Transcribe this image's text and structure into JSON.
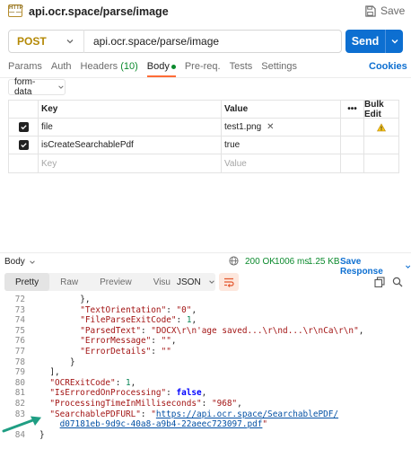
{
  "header": {
    "title": "api.ocr.space/parse/image",
    "save_label": "Save"
  },
  "request": {
    "method": "POST",
    "url": "api.ocr.space/parse/image",
    "send_label": "Send"
  },
  "tabs": [
    {
      "label": "Params"
    },
    {
      "label": "Auth"
    },
    {
      "label": "Headers",
      "count": "(10)"
    },
    {
      "label": "Body",
      "active": true,
      "dot": true
    },
    {
      "label": "Pre-req."
    },
    {
      "label": "Tests"
    },
    {
      "label": "Settings"
    }
  ],
  "cookies_label": "Cookies",
  "body_type": "form-data",
  "kv_table": {
    "headers": {
      "key": "Key",
      "value": "Value",
      "bulk": "Bulk Edit"
    },
    "rows": [
      {
        "checked": true,
        "key": "file",
        "value": "test1.png",
        "file": true,
        "warning": true
      },
      {
        "checked": true,
        "key": "isCreateSearchablePdf",
        "value": "true"
      }
    ],
    "placeholder": {
      "key": "Key",
      "value": "Value"
    }
  },
  "response": {
    "section_label": "Body",
    "status": "200 OK",
    "time": "1006 ms",
    "size": "1.25 KB",
    "save_label": "Save Response",
    "view_tabs": [
      "Pretty",
      "Raw",
      "Preview",
      "Visualize"
    ],
    "active_view": "Pretty",
    "format": "JSON"
  },
  "code_lines": [
    {
      "n": "72",
      "indent": 8,
      "parts": [
        [
          "p",
          "},"
        ]
      ]
    },
    {
      "n": "73",
      "indent": 8,
      "parts": [
        [
          "k",
          "\"TextOrientation\""
        ],
        [
          "p",
          ": "
        ],
        [
          "s",
          "\"0\""
        ],
        [
          "p",
          ","
        ]
      ]
    },
    {
      "n": "74",
      "indent": 8,
      "parts": [
        [
          "k",
          "\"FileParseExitCode\""
        ],
        [
          "p",
          ": "
        ],
        [
          "n",
          "1"
        ],
        [
          "p",
          ","
        ]
      ]
    },
    {
      "n": "75",
      "indent": 8,
      "parts": [
        [
          "k",
          "\"ParsedText\""
        ],
        [
          "p",
          ": "
        ],
        [
          "s",
          "\"DOCX\\r\\n'age saved...\\r\\nd...\\r\\nCa\\r\\n\""
        ],
        [
          "p",
          ","
        ]
      ]
    },
    {
      "n": "76",
      "indent": 8,
      "parts": [
        [
          "k",
          "\"ErrorMessage\""
        ],
        [
          "p",
          ": "
        ],
        [
          "s",
          "\"\""
        ],
        [
          "p",
          ","
        ]
      ]
    },
    {
      "n": "77",
      "indent": 8,
      "parts": [
        [
          "k",
          "\"ErrorDetails\""
        ],
        [
          "p",
          ": "
        ],
        [
          "s",
          "\"\""
        ]
      ]
    },
    {
      "n": "78",
      "indent": 6,
      "parts": [
        [
          "p",
          "}"
        ]
      ]
    },
    {
      "n": "79",
      "indent": 2,
      "parts": [
        [
          "p",
          "],"
        ]
      ]
    },
    {
      "n": "80",
      "indent": 2,
      "parts": [
        [
          "k",
          "\"OCRExitCode\""
        ],
        [
          "p",
          ": "
        ],
        [
          "n",
          "1"
        ],
        [
          "p",
          ","
        ]
      ]
    },
    {
      "n": "81",
      "indent": 2,
      "parts": [
        [
          "k",
          "\"IsErroredOnProcessing\""
        ],
        [
          "p",
          ": "
        ],
        [
          "b",
          "false"
        ],
        [
          "p",
          ","
        ]
      ]
    },
    {
      "n": "82",
      "indent": 2,
      "parts": [
        [
          "k",
          "\"ProcessingTimeInMilliseconds\""
        ],
        [
          "p",
          ": "
        ],
        [
          "s",
          "\"968\""
        ],
        [
          "p",
          ","
        ]
      ]
    },
    {
      "n": "83",
      "indent": 2,
      "parts": [
        [
          "k",
          "\"SearchablePDFURL\""
        ],
        [
          "p",
          ": "
        ],
        [
          "s",
          "\""
        ],
        [
          "u",
          "https://api.ocr.space/SearchablePDF/"
        ]
      ]
    },
    {
      "n": "",
      "indent": 4,
      "parts": [
        [
          "u",
          "d07181eb-9d9c-40a8-a9b4-22aeec723097.pdf"
        ],
        [
          "s",
          "\""
        ]
      ]
    },
    {
      "n": "84",
      "indent": 0,
      "parts": [
        [
          "p",
          "}"
        ]
      ]
    }
  ]
}
